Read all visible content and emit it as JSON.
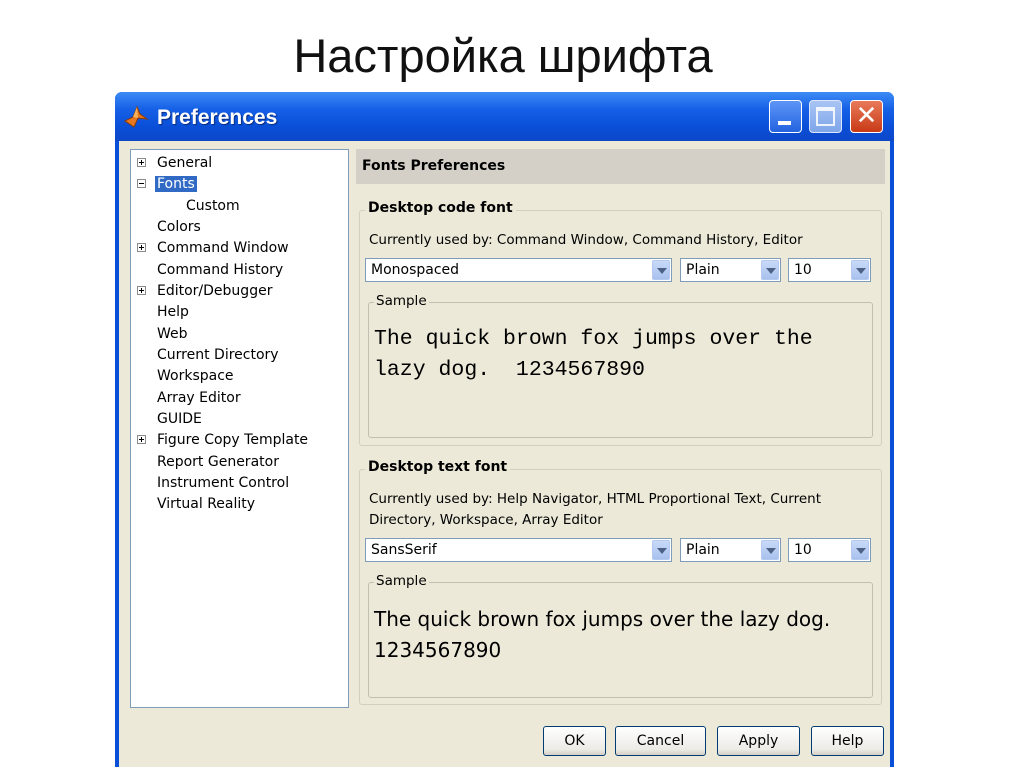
{
  "slide": {
    "title": "Настройка шрифта"
  },
  "window": {
    "title": "Preferences",
    "icon": "matlab-icon",
    "controls": [
      "minimize-icon",
      "maximize-icon",
      "close-icon"
    ]
  },
  "tree": {
    "items": [
      {
        "label": "General",
        "expander": "plus"
      },
      {
        "label": "Fonts",
        "expander": "minus",
        "selected": true
      },
      {
        "label": "Custom",
        "child": true
      },
      {
        "label": "Colors"
      },
      {
        "label": "Command Window",
        "expander": "plus"
      },
      {
        "label": "Command History"
      },
      {
        "label": "Editor/Debugger",
        "expander": "plus"
      },
      {
        "label": "Help"
      },
      {
        "label": "Web"
      },
      {
        "label": "Current Directory"
      },
      {
        "label": "Workspace"
      },
      {
        "label": "Array Editor"
      },
      {
        "label": "GUIDE"
      },
      {
        "label": "Figure Copy Template",
        "expander": "plus"
      },
      {
        "label": "Report Generator"
      },
      {
        "label": "Instrument Control"
      },
      {
        "label": "Virtual Reality"
      }
    ]
  },
  "panel": {
    "header": "Fonts Preferences",
    "code_font": {
      "title": "Desktop code font",
      "used_by": "Currently used by: Command Window, Command History, Editor",
      "family": "Monospaced",
      "style": "Plain",
      "size": "10",
      "sample_label": "Sample",
      "sample_line1": "The quick brown fox jumps over the",
      "sample_line2": "lazy dog.  1234567890"
    },
    "text_font": {
      "title": "Desktop text font",
      "used_by_line1": "Currently used by: Help Navigator, HTML Proportional Text, Current",
      "used_by_line2": "Directory, Workspace, Array Editor",
      "family": "SansSerif",
      "style": "Plain",
      "size": "10",
      "sample_label": "Sample",
      "sample_line1": "The quick brown fox jumps over the lazy dog.",
      "sample_line2": "1234567890"
    }
  },
  "buttons": {
    "ok": "OK",
    "cancel": "Cancel",
    "apply": "Apply",
    "help": "Help"
  },
  "colors": {
    "titlebar": "#0a4fd8",
    "dialog_bg": "#ece9d8",
    "selection": "#316ac5"
  }
}
